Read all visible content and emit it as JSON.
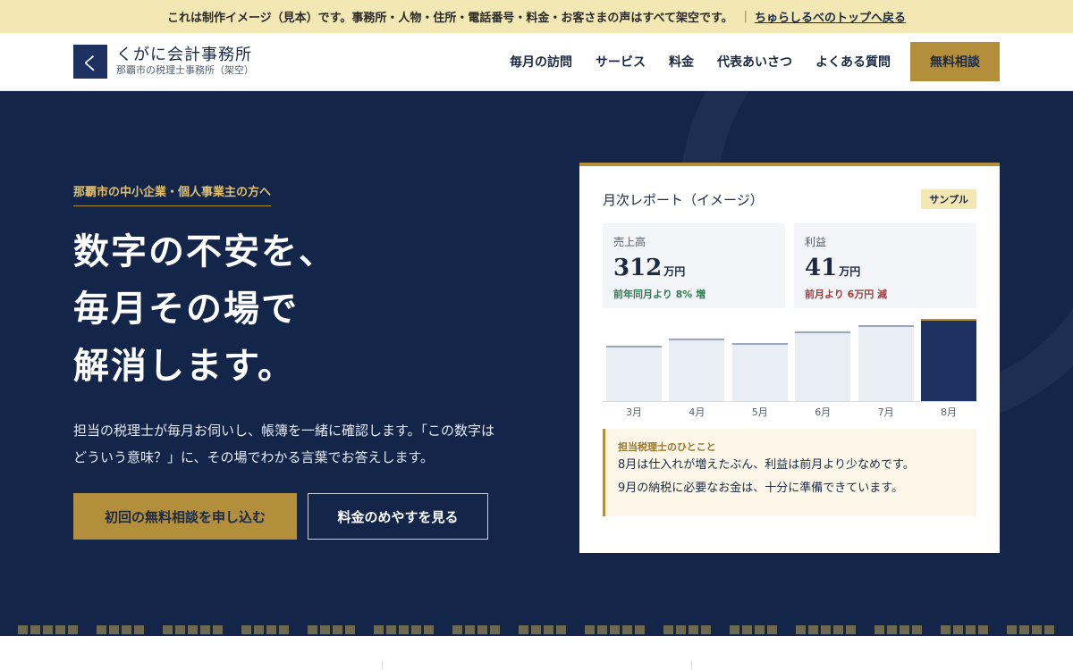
{
  "notice": {
    "text": "これは制作イメージ（見本）です。事務所・人物・住所・電話番号・料金・お客さまの声はすべて架空です。",
    "separator": "|",
    "link": "ちゅらしるべのトップへ戻る"
  },
  "header": {
    "logo_char": "く",
    "office_name": "くがに会計事務所",
    "office_sub": "那覇市の税理士事務所（架空）",
    "nav": [
      "毎月の訪問",
      "サービス",
      "料金",
      "代表あいさつ",
      "よくある質問"
    ],
    "cta": "無料相談"
  },
  "hero": {
    "eyebrow": "那覇市の中小企業・個人事業主の方へ",
    "headline": [
      "数字の不安を、",
      "毎月その場で",
      "解消します。"
    ],
    "lead": [
      "担当の税理士が毎月お伺いし、帳簿を一緒に確認します。「この数字は",
      "どういう意味？」に、その場でわかる言葉でお答えします。"
    ],
    "primary_button": "初回の無料相談を申し込む",
    "secondary_button": "料金のめやすを見る"
  },
  "report": {
    "title": "月次レポート（イメージ）",
    "badge": "サンプル",
    "metrics": [
      {
        "label": "売上高",
        "value": "312",
        "unit": "万円",
        "change": "前年同月より 8% 増",
        "trend": "up"
      },
      {
        "label": "利益",
        "value": "41",
        "unit": "万円",
        "change": "前月より 6万円 減",
        "trend": "down"
      }
    ],
    "comment_title": "担当税理士のひとこと",
    "comment_lines": [
      "8月は仕入れが増えたぶん、利益は前月より少なめです。",
      "9月の納税に必要なお金は、十分に準備できています。"
    ]
  },
  "chart_data": {
    "type": "bar",
    "categories": [
      "3月",
      "4月",
      "5月",
      "6月",
      "7月",
      "8月"
    ],
    "values": [
      60,
      68,
      63,
      75,
      82,
      89
    ],
    "highlight_index": 5,
    "colors": {
      "bar": "#e9edf4",
      "highlight": "#1d3260",
      "accent": "#b38f3c"
    }
  },
  "colors": {
    "navy": "#13264a",
    "gold": "#b38f3c",
    "notice_bg": "#f3e7b3"
  }
}
